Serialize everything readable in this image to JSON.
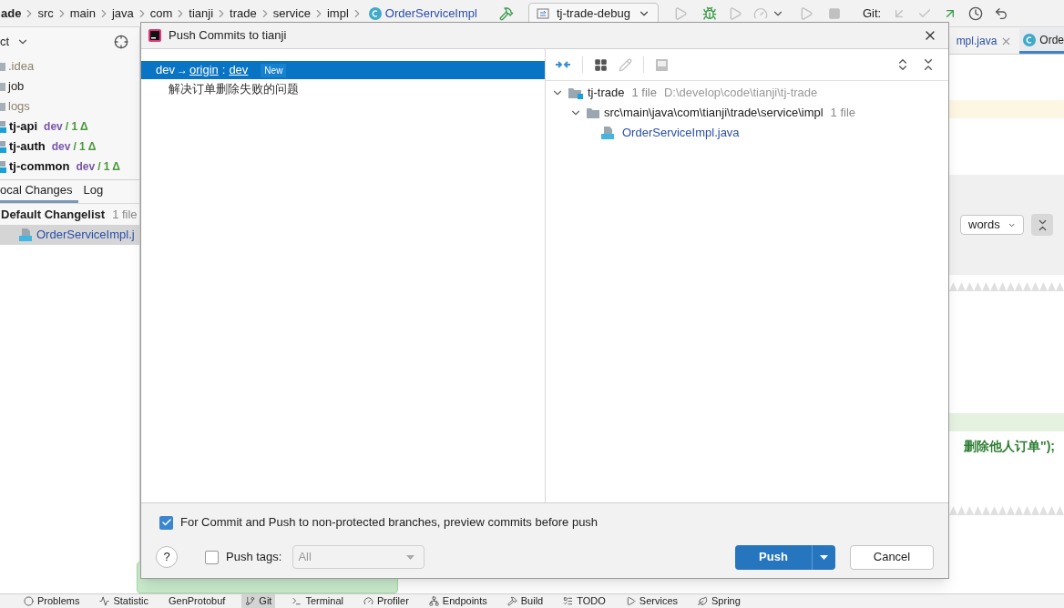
{
  "breadcrumbs": [
    "ade",
    "src",
    "main",
    "java",
    "com",
    "tianji",
    "trade",
    "service",
    "impl",
    "OrderServiceImpl"
  ],
  "toolbar": {
    "run_config": "tj-trade-debug",
    "git_label": "Git:"
  },
  "project_panel": {
    "title": "ct",
    "items": [
      {
        "name": ".idea",
        "kind": "excluded"
      },
      {
        "name": "job",
        "kind": "folder"
      },
      {
        "name": "logs",
        "kind": "excluded"
      },
      {
        "name": "tj-api",
        "kind": "module",
        "branch": "dev",
        "status": "/ 1 Δ"
      },
      {
        "name": "tj-auth",
        "kind": "module",
        "branch": "dev",
        "status": "/ 1 Δ"
      },
      {
        "name": "tj-common",
        "kind": "module",
        "branch": "dev",
        "status": "/ 1 Δ"
      }
    ]
  },
  "vcs_tabs": [
    {
      "label": "ocal Changes",
      "selected": true
    },
    {
      "label": "Log",
      "selected": false
    }
  ],
  "changelist": {
    "name": "Default Changelist",
    "count": "1 file",
    "files": [
      {
        "name": "OrderServiceImpl.j",
        "selected": true
      }
    ]
  },
  "editor_tabs": [
    {
      "label": "mpl.java",
      "selected": false,
      "closable": true
    },
    {
      "label": "Orde",
      "selected": true,
      "closable": false
    }
  ],
  "editor": {
    "scope": "words",
    "code_fragment": "删除他人订单\");"
  },
  "dialog": {
    "title": "Push Commits to tianji",
    "commits": [
      {
        "source": "dev",
        "arrow": "→",
        "remote": "origin",
        "colon": ":",
        "target": "dev",
        "badge": "New",
        "selected": true,
        "messages": [
          "解决订单删除失败的问题"
        ]
      }
    ],
    "changes": [
      {
        "name": "tj-trade",
        "kind": "module",
        "count": "1 file",
        "path": "D:\\develop\\code\\tianji\\tj-trade",
        "expanded": true,
        "children": [
          {
            "name": "src\\main\\java\\com\\tianji\\trade\\service\\impl",
            "kind": "folder",
            "count": "1 file",
            "expanded": true,
            "children": [
              {
                "name": "OrderServiceImpl.java",
                "kind": "file"
              }
            ]
          }
        ]
      }
    ],
    "preview_option": {
      "label": "For Commit and Push to non-protected branches, preview commits before push",
      "checked": true
    },
    "help": "?",
    "push_tags": {
      "label": "Push tags:",
      "checked": false,
      "value": "All",
      "disabled": true
    },
    "push_button": "Push",
    "cancel_button": "Cancel"
  },
  "tool_windows": [
    {
      "label": "Problems",
      "selected": false
    },
    {
      "label": "Statistic",
      "selected": false
    },
    {
      "label": "GenProtobuf",
      "selected": false
    },
    {
      "label": "Git",
      "selected": true
    },
    {
      "label": "Terminal",
      "selected": false
    },
    {
      "label": "Profiler",
      "selected": false
    },
    {
      "label": "Endpoints",
      "selected": false
    },
    {
      "label": "Build",
      "selected": false
    },
    {
      "label": "TODO",
      "selected": false
    },
    {
      "label": "Services",
      "selected": false
    },
    {
      "label": "Spring",
      "selected": false
    }
  ]
}
